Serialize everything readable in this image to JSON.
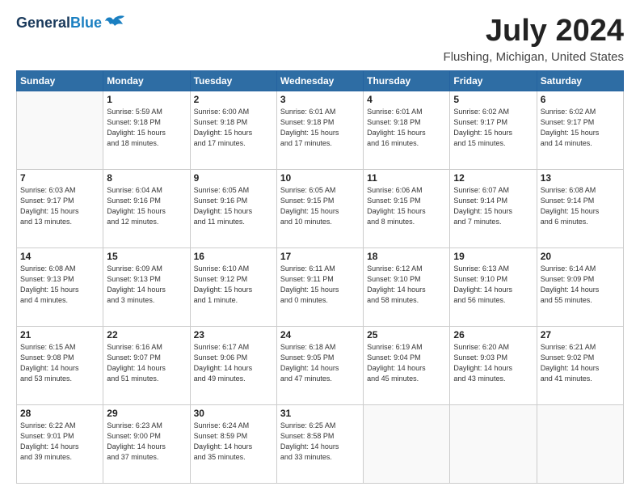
{
  "header": {
    "logo_line1": "General",
    "logo_line2": "Blue",
    "month_year": "July 2024",
    "location": "Flushing, Michigan, United States"
  },
  "weekdays": [
    "Sunday",
    "Monday",
    "Tuesday",
    "Wednesday",
    "Thursday",
    "Friday",
    "Saturday"
  ],
  "weeks": [
    [
      {
        "day": "",
        "text": ""
      },
      {
        "day": "1",
        "text": "Sunrise: 5:59 AM\nSunset: 9:18 PM\nDaylight: 15 hours\nand 18 minutes."
      },
      {
        "day": "2",
        "text": "Sunrise: 6:00 AM\nSunset: 9:18 PM\nDaylight: 15 hours\nand 17 minutes."
      },
      {
        "day": "3",
        "text": "Sunrise: 6:01 AM\nSunset: 9:18 PM\nDaylight: 15 hours\nand 17 minutes."
      },
      {
        "day": "4",
        "text": "Sunrise: 6:01 AM\nSunset: 9:18 PM\nDaylight: 15 hours\nand 16 minutes."
      },
      {
        "day": "5",
        "text": "Sunrise: 6:02 AM\nSunset: 9:17 PM\nDaylight: 15 hours\nand 15 minutes."
      },
      {
        "day": "6",
        "text": "Sunrise: 6:02 AM\nSunset: 9:17 PM\nDaylight: 15 hours\nand 14 minutes."
      }
    ],
    [
      {
        "day": "7",
        "text": "Sunrise: 6:03 AM\nSunset: 9:17 PM\nDaylight: 15 hours\nand 13 minutes."
      },
      {
        "day": "8",
        "text": "Sunrise: 6:04 AM\nSunset: 9:16 PM\nDaylight: 15 hours\nand 12 minutes."
      },
      {
        "day": "9",
        "text": "Sunrise: 6:05 AM\nSunset: 9:16 PM\nDaylight: 15 hours\nand 11 minutes."
      },
      {
        "day": "10",
        "text": "Sunrise: 6:05 AM\nSunset: 9:15 PM\nDaylight: 15 hours\nand 10 minutes."
      },
      {
        "day": "11",
        "text": "Sunrise: 6:06 AM\nSunset: 9:15 PM\nDaylight: 15 hours\nand 8 minutes."
      },
      {
        "day": "12",
        "text": "Sunrise: 6:07 AM\nSunset: 9:14 PM\nDaylight: 15 hours\nand 7 minutes."
      },
      {
        "day": "13",
        "text": "Sunrise: 6:08 AM\nSunset: 9:14 PM\nDaylight: 15 hours\nand 6 minutes."
      }
    ],
    [
      {
        "day": "14",
        "text": "Sunrise: 6:08 AM\nSunset: 9:13 PM\nDaylight: 15 hours\nand 4 minutes."
      },
      {
        "day": "15",
        "text": "Sunrise: 6:09 AM\nSunset: 9:13 PM\nDaylight: 14 hours\nand 3 minutes."
      },
      {
        "day": "16",
        "text": "Sunrise: 6:10 AM\nSunset: 9:12 PM\nDaylight: 15 hours\nand 1 minute."
      },
      {
        "day": "17",
        "text": "Sunrise: 6:11 AM\nSunset: 9:11 PM\nDaylight: 15 hours\nand 0 minutes."
      },
      {
        "day": "18",
        "text": "Sunrise: 6:12 AM\nSunset: 9:10 PM\nDaylight: 14 hours\nand 58 minutes."
      },
      {
        "day": "19",
        "text": "Sunrise: 6:13 AM\nSunset: 9:10 PM\nDaylight: 14 hours\nand 56 minutes."
      },
      {
        "day": "20",
        "text": "Sunrise: 6:14 AM\nSunset: 9:09 PM\nDaylight: 14 hours\nand 55 minutes."
      }
    ],
    [
      {
        "day": "21",
        "text": "Sunrise: 6:15 AM\nSunset: 9:08 PM\nDaylight: 14 hours\nand 53 minutes."
      },
      {
        "day": "22",
        "text": "Sunrise: 6:16 AM\nSunset: 9:07 PM\nDaylight: 14 hours\nand 51 minutes."
      },
      {
        "day": "23",
        "text": "Sunrise: 6:17 AM\nSunset: 9:06 PM\nDaylight: 14 hours\nand 49 minutes."
      },
      {
        "day": "24",
        "text": "Sunrise: 6:18 AM\nSunset: 9:05 PM\nDaylight: 14 hours\nand 47 minutes."
      },
      {
        "day": "25",
        "text": "Sunrise: 6:19 AM\nSunset: 9:04 PM\nDaylight: 14 hours\nand 45 minutes."
      },
      {
        "day": "26",
        "text": "Sunrise: 6:20 AM\nSunset: 9:03 PM\nDaylight: 14 hours\nand 43 minutes."
      },
      {
        "day": "27",
        "text": "Sunrise: 6:21 AM\nSunset: 9:02 PM\nDaylight: 14 hours\nand 41 minutes."
      }
    ],
    [
      {
        "day": "28",
        "text": "Sunrise: 6:22 AM\nSunset: 9:01 PM\nDaylight: 14 hours\nand 39 minutes."
      },
      {
        "day": "29",
        "text": "Sunrise: 6:23 AM\nSunset: 9:00 PM\nDaylight: 14 hours\nand 37 minutes."
      },
      {
        "day": "30",
        "text": "Sunrise: 6:24 AM\nSunset: 8:59 PM\nDaylight: 14 hours\nand 35 minutes."
      },
      {
        "day": "31",
        "text": "Sunrise: 6:25 AM\nSunset: 8:58 PM\nDaylight: 14 hours\nand 33 minutes."
      },
      {
        "day": "",
        "text": ""
      },
      {
        "day": "",
        "text": ""
      },
      {
        "day": "",
        "text": ""
      }
    ]
  ]
}
